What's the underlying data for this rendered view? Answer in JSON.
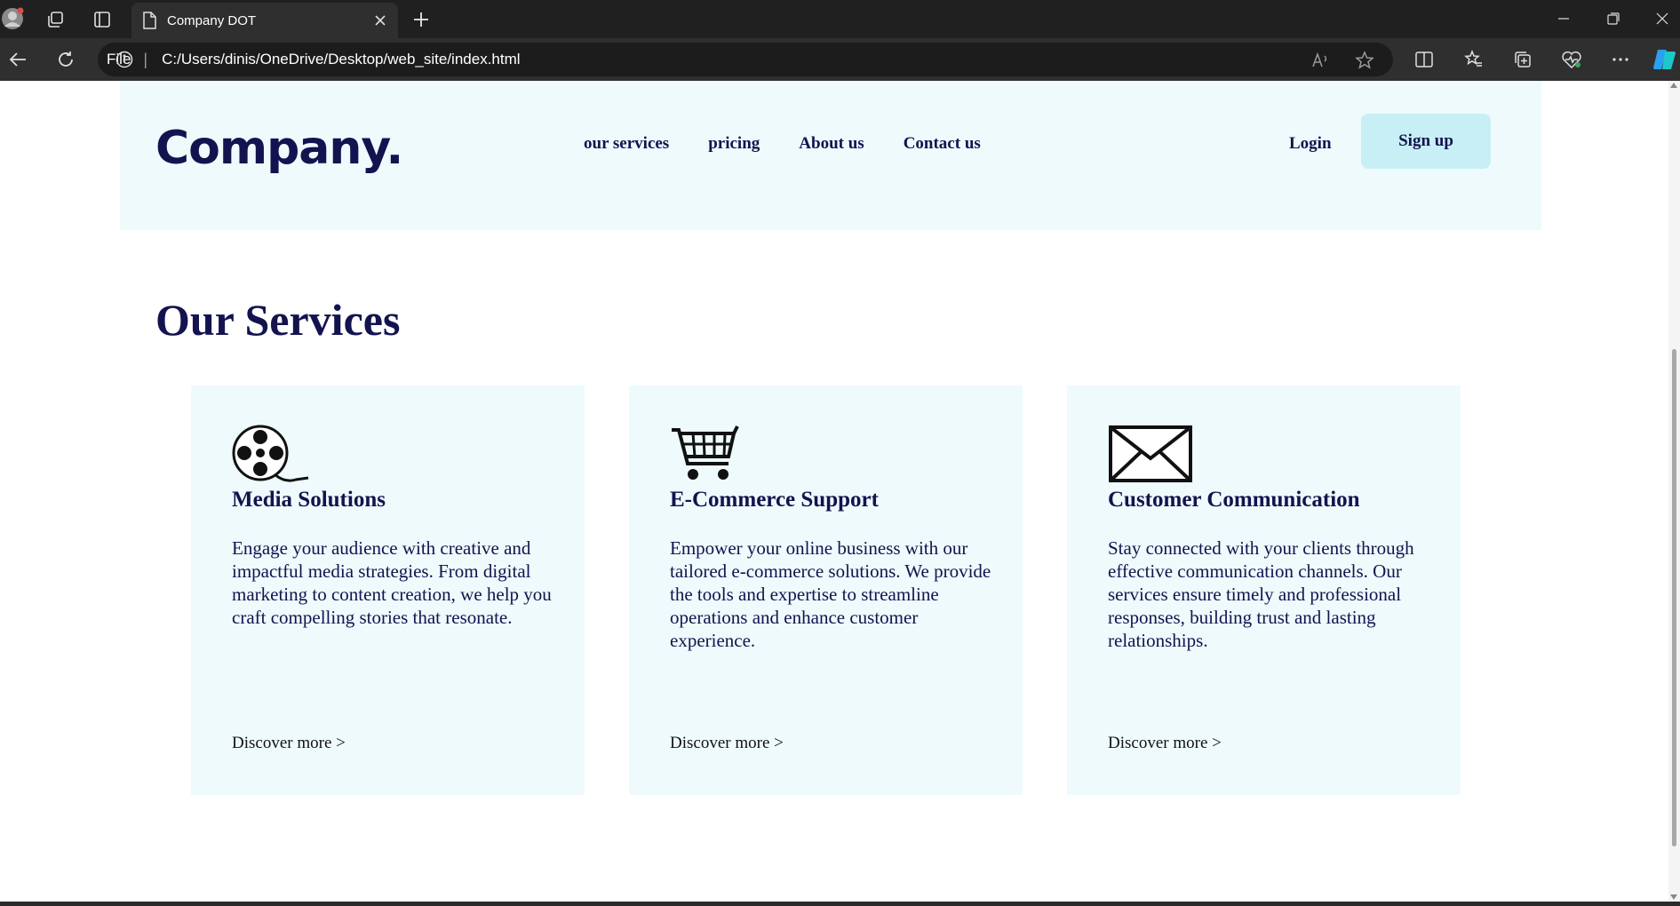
{
  "browser": {
    "tab_title": "Company DOT",
    "address_scheme": "File",
    "address_url": "C:/Users/dinis/OneDrive/Desktop/web_site/index.html"
  },
  "site": {
    "logo": "Company.",
    "nav": [
      "our services",
      "pricing",
      "About us",
      "Contact us"
    ],
    "login": "Login",
    "signup": "Sign up"
  },
  "services": {
    "title": "Our Services",
    "cards": [
      {
        "icon": "film-reel-icon",
        "title": "Media Solutions",
        "text": "Engage your audience with creative and impactful media strategies. From digital marketing to content creation, we help you craft compelling stories that resonate.",
        "link": "Discover more >"
      },
      {
        "icon": "shopping-cart-icon",
        "title": "E-Commerce Support",
        "text": "Empower your online business with our tailored e-commerce solutions. We provide the tools and expertise to streamline operations and enhance customer experience.",
        "link": "Discover more >"
      },
      {
        "icon": "envelope-icon",
        "title": "Customer Communication",
        "text": "Stay connected with your clients through effective communication channels. Our services ensure timely and professional responses, building trust and lasting relationships.",
        "link": "Discover more >"
      }
    ]
  },
  "colors": {
    "navy": "#13134f",
    "light_bg": "#eefafc",
    "signup_bg": "#c8eff5"
  }
}
